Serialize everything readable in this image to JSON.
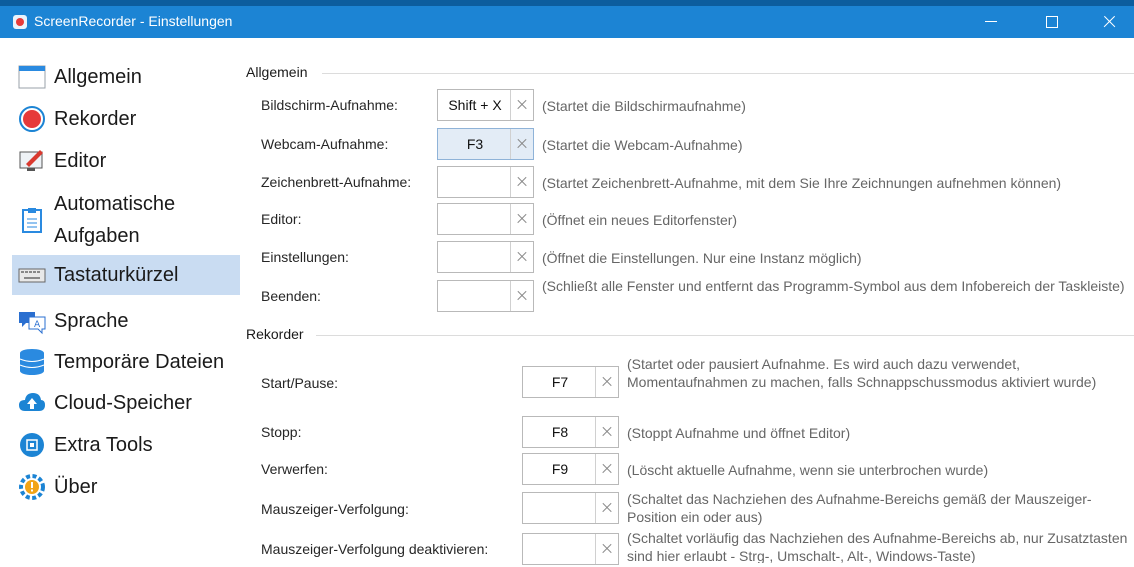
{
  "window": {
    "title": "ScreenRecorder - Einstellungen"
  },
  "sidebar": {
    "items": [
      {
        "label": "Allgemein",
        "icon": "window-icon"
      },
      {
        "label": "Rekorder",
        "icon": "record-icon"
      },
      {
        "label": "Editor",
        "icon": "editor-icon"
      },
      {
        "label": "Automatische Aufgaben",
        "icon": "clipboard-icon"
      },
      {
        "label": "Tastaturkürzel",
        "icon": "keyboard-icon",
        "active": true
      },
      {
        "label": "Sprache",
        "icon": "language-icon"
      },
      {
        "label": "Temporäre Dateien",
        "icon": "database-icon"
      },
      {
        "label": "Cloud-Speicher",
        "icon": "cloud-upload-icon"
      },
      {
        "label": "Extra Tools",
        "icon": "chip-icon"
      },
      {
        "label": "Über",
        "icon": "info-gear-icon"
      }
    ]
  },
  "sections": {
    "general": {
      "title": "Allgemein",
      "rows": [
        {
          "label": "Bildschirm-Aufnahme:",
          "value": "Shift + X",
          "desc": "(Startet die Bildschirmaufnahme)"
        },
        {
          "label": "Webcam-Aufnahme:",
          "value": "F3",
          "desc": "(Startet die Webcam-Aufnahme)"
        },
        {
          "label": "Zeichenbrett-Aufnahme:",
          "value": "",
          "desc": "(Startet Zeichenbrett-Aufnahme, mit dem Sie Ihre Zeichnungen aufnehmen können)"
        },
        {
          "label": "Editor:",
          "value": "",
          "desc": "(Öffnet ein neues Editorfenster)"
        },
        {
          "label": "Einstellungen:",
          "value": "",
          "desc": "(Öffnet die Einstellungen. Nur eine Instanz möglich)"
        },
        {
          "label": "Beenden:",
          "value": "",
          "desc": "(Schließt alle Fenster und entfernt das Programm-Symbol aus dem Infobereich der Taskleiste)"
        }
      ]
    },
    "recorder": {
      "title": "Rekorder",
      "rows": [
        {
          "label": "Start/Pause:",
          "value": "F7",
          "desc": "(Startet oder pausiert Aufnahme. Es wird auch dazu verwendet, Momentaufnahmen zu machen, falls Schnappschussmodus aktiviert wurde)"
        },
        {
          "label": "Stopp:",
          "value": "F8",
          "desc": "(Stoppt Aufnahme und öffnet Editor)"
        },
        {
          "label": "Verwerfen:",
          "value": "F9",
          "desc": "(Löscht aktuelle Aufnahme, wenn sie unterbrochen wurde)"
        },
        {
          "label": "Mauszeiger-Verfolgung:",
          "value": "",
          "desc": "(Schaltet das Nachziehen des Aufnahme-Bereichs gemäß der Mauszeiger-Position ein oder aus)"
        },
        {
          "label": "Mauszeiger-Verfolgung deaktivieren:",
          "value": "",
          "desc": "(Schaltet vorläufig das Nachziehen des Aufnahme-Bereichs ab, nur Zusatztasten sind hier erlaubt - Strg-, Umschalt-, Alt-, Windows-Taste)"
        }
      ]
    }
  },
  "colors": {
    "titlebar": "#1c84d4",
    "active_nav": "#c9dcf2",
    "record_red": "#e63a3a",
    "accent_blue": "#1c84d4"
  }
}
